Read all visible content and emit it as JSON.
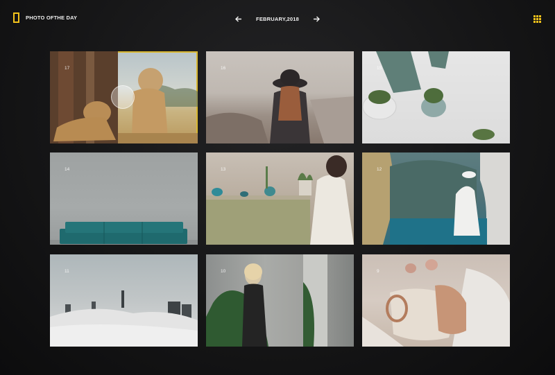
{
  "header": {
    "brand_title": "PHOTO OFTHE DAY",
    "month_label": "FEBRUARY,2018",
    "prev_icon": "arrow-left-icon",
    "next_icon": "arrow-right-icon",
    "view_toggle_icon": "grid-icon"
  },
  "colors": {
    "accent": "#f2c21b",
    "background": "#161617",
    "selected_outline": "#d9b730"
  },
  "gallery": {
    "selected_day": "17",
    "cards": [
      {
        "day": "17",
        "subject": "lions"
      },
      {
        "day": "16",
        "subject": "beach"
      },
      {
        "day": "15",
        "subject": "plants"
      },
      {
        "day": "14",
        "subject": "couch"
      },
      {
        "day": "13",
        "subject": "pots"
      },
      {
        "day": "12",
        "subject": "coast"
      },
      {
        "day": "11",
        "subject": "city"
      },
      {
        "day": "10",
        "subject": "woman"
      },
      {
        "day": "9",
        "subject": "cup"
      }
    ]
  }
}
